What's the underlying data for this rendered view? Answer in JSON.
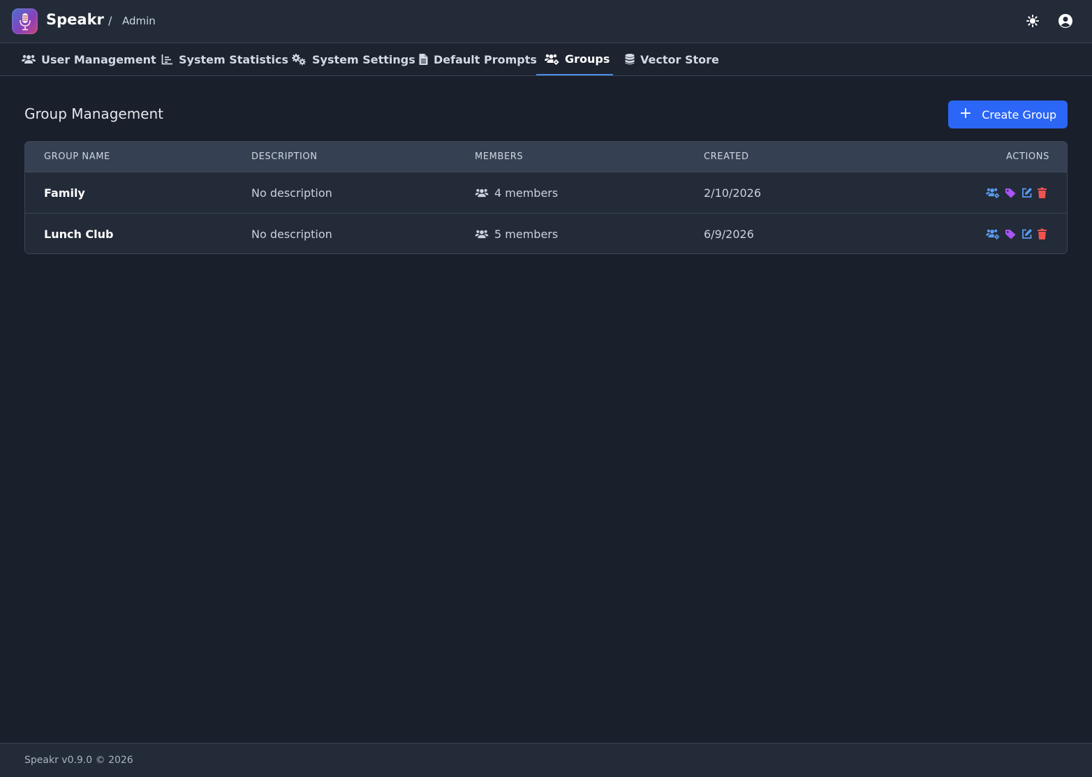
{
  "header": {
    "brand": "Speakr",
    "separator": "/",
    "breadcrumb": "Admin"
  },
  "tabs": [
    {
      "label": "User Management",
      "icon": "users-icon"
    },
    {
      "label": "System Statistics",
      "icon": "chart-line-icon"
    },
    {
      "label": "System Settings",
      "icon": "cogs-icon"
    },
    {
      "label": "Default Prompts",
      "icon": "document-icon"
    },
    {
      "label": "Groups",
      "icon": "users-cog-icon",
      "active": true
    },
    {
      "label": "Vector Store",
      "icon": "database-icon"
    }
  ],
  "main": {
    "title": "Group Management",
    "create_button": "Create Group"
  },
  "table": {
    "columns": [
      "GROUP NAME",
      "DESCRIPTION",
      "MEMBERS",
      "CREATED",
      "ACTIONS"
    ],
    "rows": [
      {
        "name": "Family",
        "description": "No description",
        "members": "4 members",
        "created": "2/10/2026"
      },
      {
        "name": "Lunch Club",
        "description": "No description",
        "members": "5 members",
        "created": "6/9/2026"
      }
    ]
  },
  "footer": {
    "text": "Speakr v0.9.0 © 2026"
  },
  "colors": {
    "accent": "#2b66f6",
    "active_tab_underline": "#4a8fe6",
    "manage_icon": "#5b9bf0",
    "tag_icon": "#a855f7",
    "edit_icon": "#5b9bf0",
    "delete_icon": "#ef5350"
  }
}
